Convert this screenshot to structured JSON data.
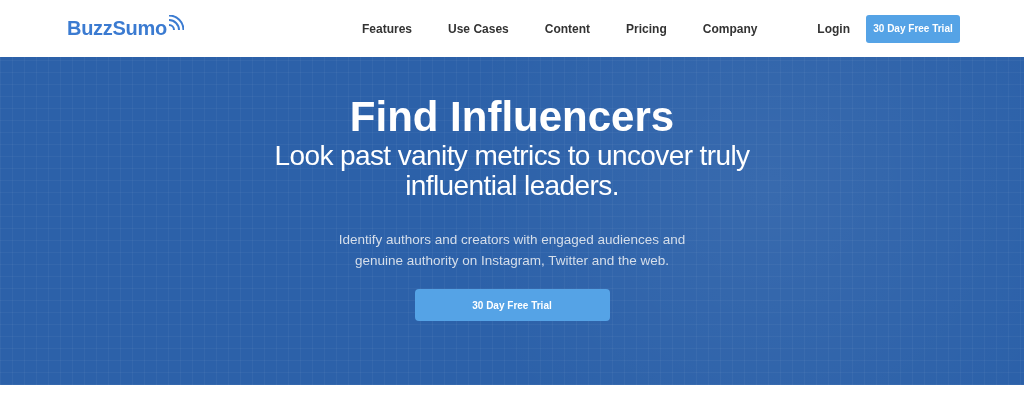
{
  "header": {
    "logo": "BuzzSumo",
    "nav": [
      {
        "label": "Features"
      },
      {
        "label": "Use Cases"
      },
      {
        "label": "Content"
      },
      {
        "label": "Pricing"
      },
      {
        "label": "Company"
      }
    ],
    "login": "Login",
    "cta": "30 Day Free Trial"
  },
  "hero": {
    "title": "Find Influencers",
    "subtitle": "Look past vanity metrics to uncover truly influential leaders.",
    "description": "Identify authors and creators with engaged audiences and genuine authority on Instagram, Twitter and the web.",
    "cta": "30 Day Free Trial"
  }
}
